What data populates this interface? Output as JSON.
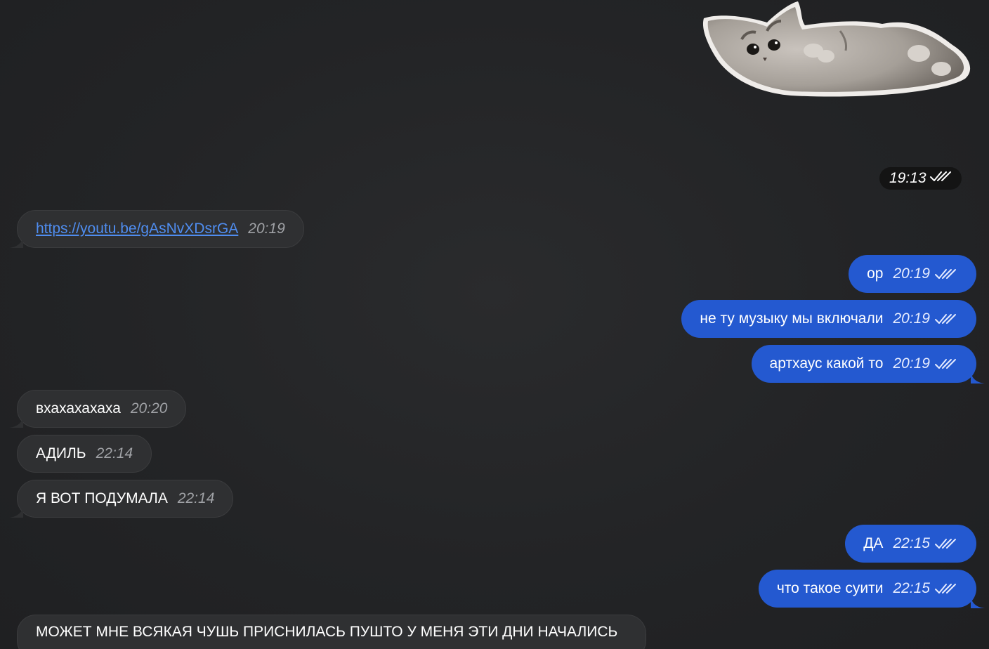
{
  "sticker": {
    "time": "19:13"
  },
  "messages": [
    {
      "id": "m1",
      "dir": "in",
      "text": "https://youtu.be/gAsNvXDsrGA",
      "time": "20:19",
      "is_link": true
    },
    {
      "id": "m2",
      "dir": "out",
      "text": "ор",
      "time": "20:19"
    },
    {
      "id": "m3",
      "dir": "out",
      "text": "не ту музыку мы включали",
      "time": "20:19"
    },
    {
      "id": "m4",
      "dir": "out",
      "text": "артхаус какой то",
      "time": "20:19"
    },
    {
      "id": "m5",
      "dir": "in",
      "text": "вхахахахаха",
      "time": "20:20"
    },
    {
      "id": "m6",
      "dir": "in",
      "text": "АДИЛЬ",
      "time": "22:14"
    },
    {
      "id": "m7",
      "dir": "in",
      "text": "Я ВОТ ПОДУМАЛА",
      "time": "22:14"
    },
    {
      "id": "m8",
      "dir": "out",
      "text": "ДА",
      "time": "22:15"
    },
    {
      "id": "m9",
      "dir": "out",
      "text": "что такое суити",
      "time": "22:15"
    },
    {
      "id": "m10",
      "dir": "in",
      "text": "МОЖЕТ МНЕ ВСЯКАЯ ЧУШЬ ПРИСНИЛАСЬ ПУШТО У МЕНЯ ЭТИ ДНИ НАЧАЛИСЬ",
      "time": ""
    }
  ],
  "colors": {
    "background": "#232426",
    "incoming_bubble": "#2f3032",
    "outgoing_bubble": "#2459d0",
    "link": "#4f8df0"
  },
  "icons": {
    "read_receipt": "double-check-icon",
    "sticker": "kitten-sticker-icon"
  }
}
